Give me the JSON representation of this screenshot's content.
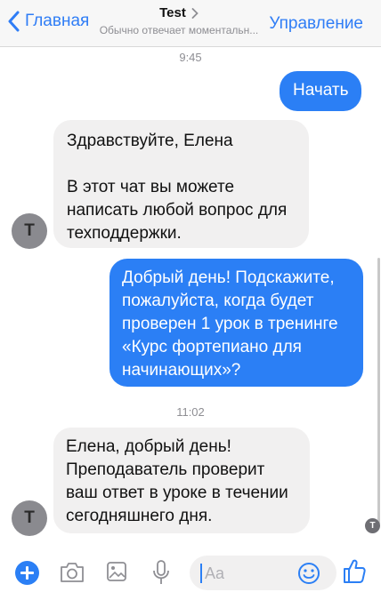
{
  "header": {
    "back_label": "Главная",
    "title": "Test",
    "subtitle": "Обычно отвечает моментальн...",
    "manage_label": "Управление"
  },
  "messages": {
    "time1": "9:45",
    "start_label": "Начать",
    "greeting_1": "Здравствуйте, Елена",
    "greeting_2": "В этот чат вы можете написать любой вопрос для техподдержки.",
    "question": "Добрый день! Подскажите, пожалуйста, когда будет проверен 1 урок в тренинге «Курс фортепиано для начинающих»?",
    "time2": "11:02",
    "answer": "Елена, добрый день! Преподаватель проверит ваш ответ в уроке в течении сегодняшнего дня.",
    "avatar_letter": "T",
    "seen_letter": "T"
  },
  "composer": {
    "placeholder": "Aa"
  },
  "colors": {
    "accent": "#2b7ff5",
    "incoming_bubble": "#f1f0f0",
    "avatar": "#8a8a8f"
  },
  "icons": [
    "back-chevron-icon",
    "title-chevron-icon",
    "plus-icon",
    "camera-icon",
    "gallery-icon",
    "microphone-icon",
    "emoji-icon",
    "thumbs-up-icon"
  ]
}
